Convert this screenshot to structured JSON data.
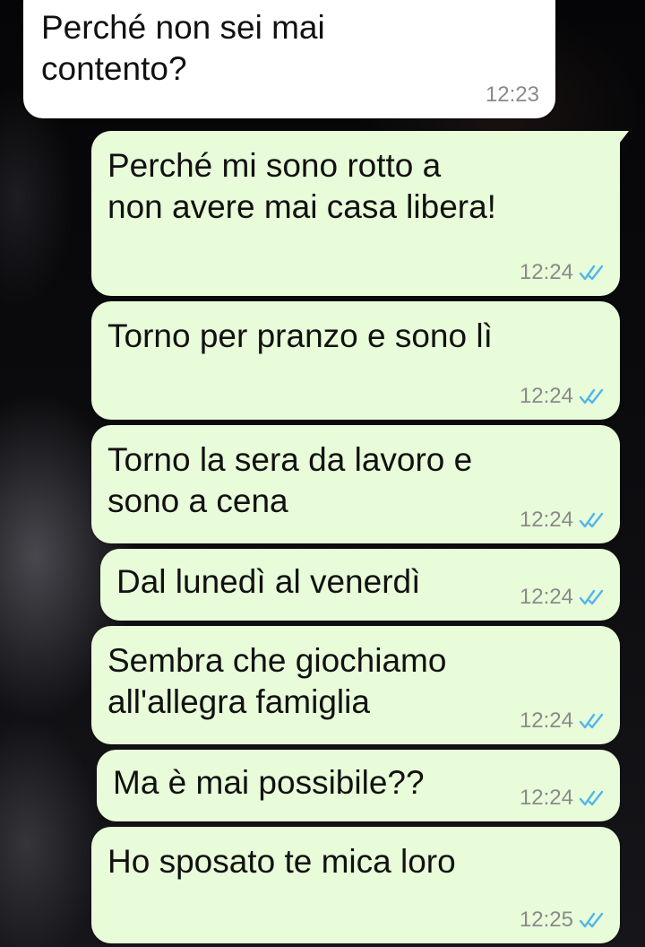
{
  "conversation": {
    "messages": [
      {
        "direction": "incoming",
        "text": "Perché non sei mai\ncontento?",
        "time": "12:23"
      },
      {
        "direction": "outgoing",
        "text": "Perché mi sono rotto a\nnon avere mai casa libera!",
        "time": "12:24",
        "status_icon": "double-check-read"
      },
      {
        "direction": "outgoing",
        "text": "Torno per pranzo e sono lì",
        "time": "12:24",
        "status_icon": "double-check-read"
      },
      {
        "direction": "outgoing",
        "text": "Torno la sera da lavoro e\nsono a cena",
        "time": "12:24",
        "status_icon": "double-check-read"
      },
      {
        "direction": "outgoing",
        "text": "Dal lunedì al venerdì",
        "time": "12:24",
        "status_icon": "double-check-read"
      },
      {
        "direction": "outgoing",
        "text": "Sembra che giochiamo\nall'allegra famiglia",
        "time": "12:24",
        "status_icon": "double-check-read"
      },
      {
        "direction": "outgoing",
        "text": "Ma è mai possibile??",
        "time": "12:24",
        "status_icon": "double-check-read"
      },
      {
        "direction": "outgoing",
        "text": "Ho sposato te mica loro",
        "time": "12:25",
        "status_icon": "double-check-read"
      }
    ]
  },
  "colors": {
    "incoming_bubble": "#ffffff",
    "outgoing_bubble": "#e8fcd9",
    "read_tick": "#4fb6ec",
    "timestamp": "#8a8a8a"
  }
}
